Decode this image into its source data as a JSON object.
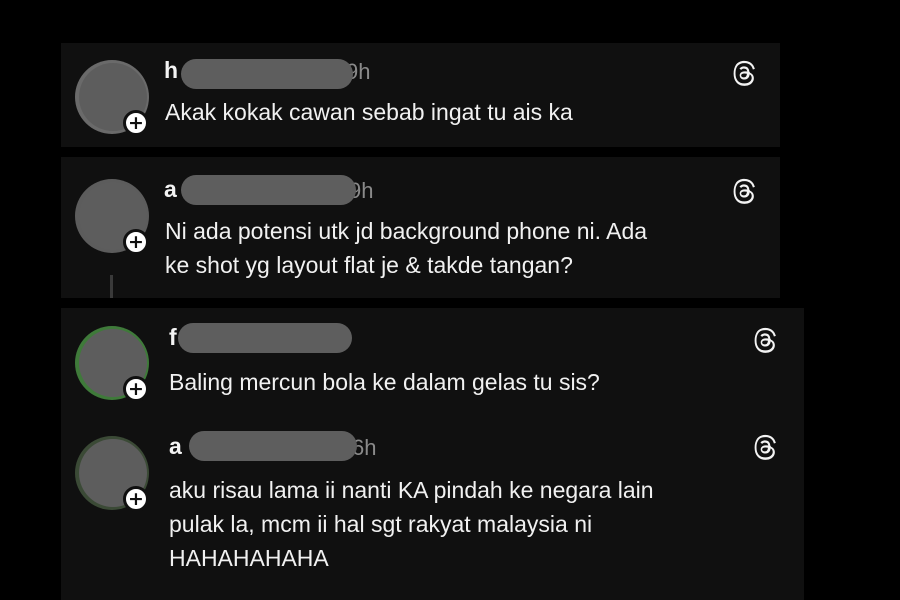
{
  "comments": [
    {
      "username_visible": "h",
      "timestamp_visible": "9h",
      "text_lines": [
        "Akak kokak cawan sebab ingat tu ais ka"
      ],
      "icon": "threads-logo-icon"
    },
    {
      "username_visible": "a",
      "timestamp_visible": "9h",
      "text_lines": [
        "Ni ada potensi utk jd background phone ni. Ada",
        "ke shot yg layout flat je & takde tangan?"
      ],
      "icon": "threads-logo-icon"
    },
    {
      "username_visible": "f",
      "timestamp_visible": "",
      "text_lines": [
        "Baling mercun bola ke dalam gelas tu sis?"
      ],
      "icon": "threads-logo-icon"
    },
    {
      "username_visible": "a",
      "timestamp_visible": "6h",
      "text_lines": [
        "aku risau lama ii nanti KA pindah ke negara lain",
        "pulak la, mcm ii hal sgt rakyat malaysia ni",
        "HAHAHAHAHA"
      ],
      "icon": "threads-logo-icon"
    }
  ],
  "follow_badge_symbol": "+",
  "colors": {
    "background": "#000000",
    "card": "#101010",
    "text": "#f1f1f1",
    "muted": "#8a8a8a",
    "redaction": "#5e5e5e"
  }
}
